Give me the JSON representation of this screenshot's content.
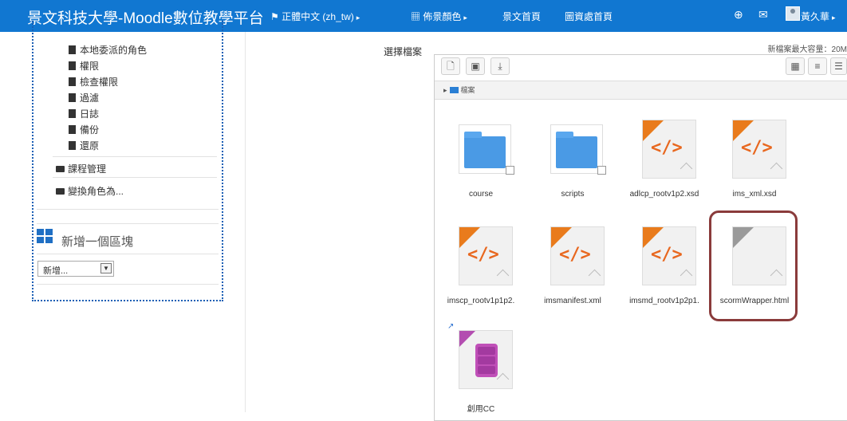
{
  "navbar": {
    "brand": "景文科技大學-Moodle數位教學平台",
    "language": "正體中文 (zh_tw)",
    "theme_color": "佈景顏色",
    "home": "景文首頁",
    "library_home": "圖資處首頁",
    "user_name": "黃久華",
    "icons": [
      "flag-icon",
      "grid-icon",
      "download-icon",
      "mail-icon",
      "user-avatar"
    ],
    "bg_color": "#1177d1"
  },
  "admin_tree": {
    "items": [
      "本地委派的角色",
      "權限",
      "檢查權限",
      "過濾",
      "日誌",
      "備份",
      "還原"
    ],
    "sections": [
      "課程管理",
      "變換角色為..."
    ]
  },
  "add_block": {
    "title": "新增一個區塊",
    "select_value": "新增..."
  },
  "file_picker": {
    "label": "選擇檔案",
    "max_size": "新檔案最大容量：20M",
    "breadcrumb": "檔案",
    "files": [
      {
        "name": "course",
        "type": "folder"
      },
      {
        "name": "scripts",
        "type": "folder"
      },
      {
        "name": "adlcp_rootv1p2.xsd",
        "type": "xml"
      },
      {
        "name": "ims_xml.xsd",
        "type": "xml"
      },
      {
        "name": "imscp_rootv1p1p2.",
        "type": "xml"
      },
      {
        "name": "imsmanifest.xml",
        "type": "xml"
      },
      {
        "name": "imsmd_rootv1p2p1.",
        "type": "xml"
      },
      {
        "name": "scormWrapper.html",
        "type": "html"
      },
      {
        "name": "創用CC",
        "type": "archive"
      }
    ],
    "highlight_color": "#8a3b3b"
  }
}
